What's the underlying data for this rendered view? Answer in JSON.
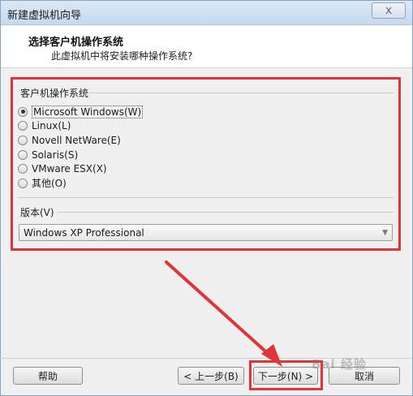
{
  "window": {
    "title": "新建虚拟机向导",
    "close_glyph": "x"
  },
  "header": {
    "title": "选择客户机操作系统",
    "subtitle": "此虚拟机中将安装哪种操作系统?"
  },
  "guest_os": {
    "group_label": "客户机操作系统",
    "options": [
      {
        "label": "Microsoft Windows(W)",
        "checked": true
      },
      {
        "label": "Linux(L)",
        "checked": false
      },
      {
        "label": "Novell NetWare(E)",
        "checked": false
      },
      {
        "label": "Solaris(S)",
        "checked": false
      },
      {
        "label": "VMware ESX(X)",
        "checked": false
      },
      {
        "label": "其他(O)",
        "checked": false
      }
    ]
  },
  "version": {
    "label": "版本(V)",
    "selected": "Windows XP Professional"
  },
  "buttons": {
    "help": "帮助",
    "back": "< 上一步(B)",
    "next": "下一步(N) >",
    "cancel": "取消"
  },
  "watermark": "Bai 经验",
  "colors": {
    "annotation_red": "#e0343a"
  }
}
